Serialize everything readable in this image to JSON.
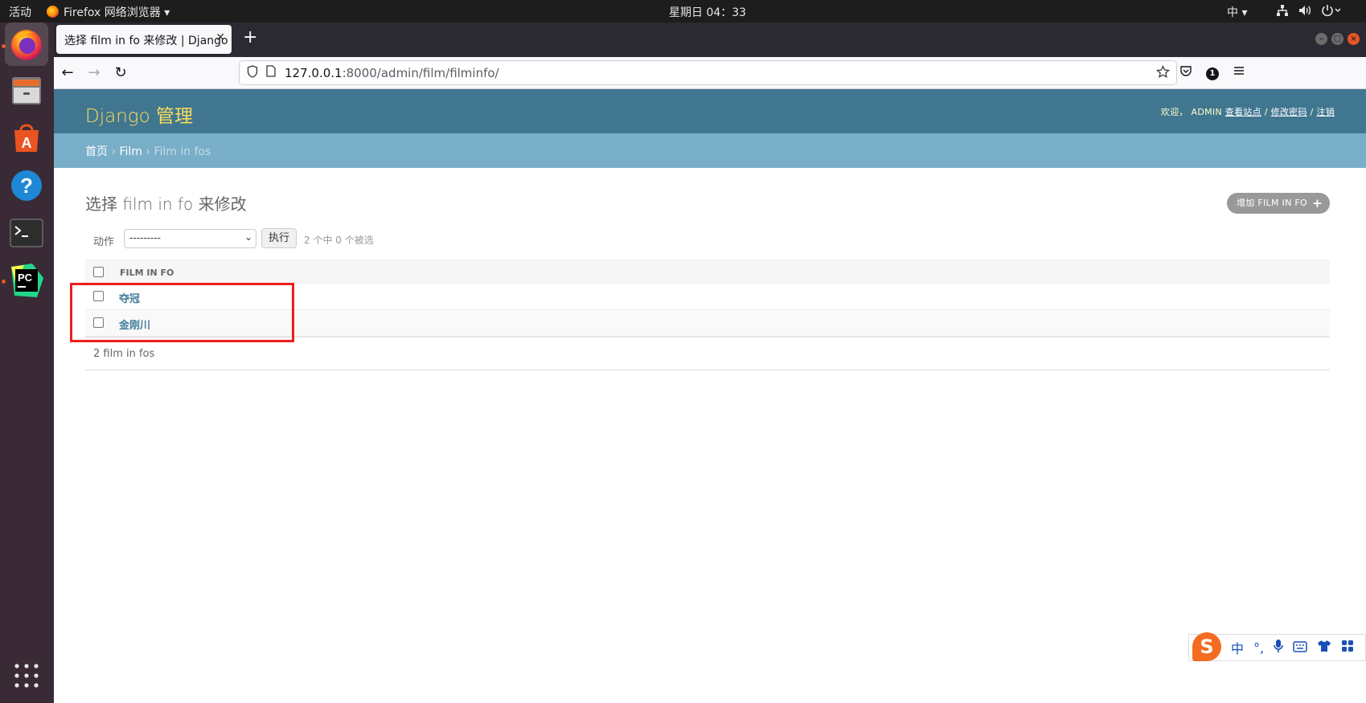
{
  "system": {
    "activities": "活动",
    "app_menu": "Firefox 网络浏览器 ▾",
    "clock": "星期日 04：33",
    "ime_indicator": "中 ▾",
    "status_icons": [
      "network-icon",
      "volume-icon",
      "power-icon"
    ]
  },
  "dock": {
    "items": [
      "firefox",
      "files",
      "software",
      "help",
      "terminal",
      "pycharm",
      "apps-grid"
    ]
  },
  "browser": {
    "tab_title": "选择 film in fo 来修改 | Django",
    "url_host": "127.0.0.1",
    "url_rest": ":8000/admin/film/filminfo/",
    "notification_count": "1"
  },
  "admin": {
    "brand": "Django 管理",
    "welcome": "欢迎，",
    "user": "ADMIN",
    "view_site": "查看站点",
    "change_password": "修改密码",
    "logout": "注销",
    "sep": " / ",
    "breadcrumbs": {
      "home": "首页",
      "app": "Film",
      "current": "Film in fos",
      "sep": " › "
    },
    "title": "选择 film in fo 来修改",
    "add_button": "增加 FILM IN FO",
    "actions": {
      "label": "动作",
      "selected_option": "---------",
      "go_button": "执行",
      "counter": "2 个中 0 个被选"
    },
    "table": {
      "column_header": "FILM IN FO",
      "rows": [
        "夺冠",
        "金刚川"
      ]
    },
    "paginator": "2 film in fos"
  },
  "ime_bar": {
    "lang": "中",
    "punct": "°,"
  },
  "colors": {
    "header_bg": "#417690",
    "brand_yellow": "#f5dd5d",
    "breadcrumbs_bg": "#79aec8",
    "link_blue": "#447e9b",
    "highlight_red": "#ee1c1c"
  }
}
